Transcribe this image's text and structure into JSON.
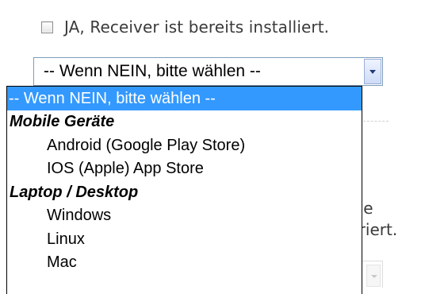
{
  "checkbox": {
    "label": "JA, Receiver ist bereits installiert.",
    "checked": false
  },
  "select": {
    "value": "-- Wenn NEIN, bitte wählen --",
    "arrow_icon": "chevron-down-icon",
    "options": [
      {
        "type": "option",
        "label": "-- Wenn NEIN, bitte wählen --",
        "selected": true
      },
      {
        "type": "group",
        "label": "Mobile Geräte"
      },
      {
        "type": "option",
        "label": "Android (Google Play Store)"
      },
      {
        "type": "option",
        "label": "IOS (Apple) App Store"
      },
      {
        "type": "group",
        "label": "Laptop / Desktop"
      },
      {
        "type": "option",
        "label": "Windows"
      },
      {
        "type": "option",
        "label": "Linux"
      },
      {
        "type": "option",
        "label": "Mac"
      }
    ]
  },
  "background": {
    "line1": "die",
    "line2": "uriert."
  },
  "colors": {
    "highlight": "#3399ff",
    "highlight_text": "#ffffff",
    "select_border": "#7f9db9"
  }
}
